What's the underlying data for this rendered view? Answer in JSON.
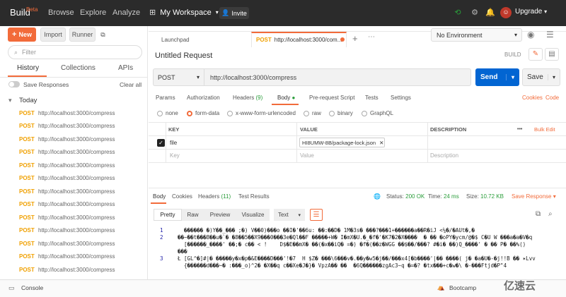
{
  "topbar": {
    "brand": "Build",
    "beta": "Beta",
    "nav": [
      "Browse",
      "Explore",
      "Analyze"
    ],
    "workspace": "My Workspace",
    "invite": "Invite",
    "upgrade": "Upgrade"
  },
  "sidebar": {
    "new_label": "New",
    "import_label": "Import",
    "runner_label": "Runner",
    "filter_placeholder": "Filter",
    "tabs": [
      "History",
      "Collections",
      "APIs"
    ],
    "save_responses": "Save Responses",
    "clear_all": "Clear all",
    "group": "Today",
    "items": [
      {
        "method": "POST",
        "url": "http://localhost:3000/compress"
      },
      {
        "method": "POST",
        "url": "http://localhost:3000/compress"
      },
      {
        "method": "POST",
        "url": "http://localhost:3000/compress"
      },
      {
        "method": "POST",
        "url": "http://localhost:3000/compress"
      },
      {
        "method": "POST",
        "url": "http://localhost:3000/compress"
      },
      {
        "method": "POST",
        "url": "http://localhost:3000/compress"
      },
      {
        "method": "POST",
        "url": "http://localhost:3000/compress"
      },
      {
        "method": "POST",
        "url": "http://localhost:3000/compress"
      },
      {
        "method": "POST",
        "url": "http://localhost:3000/compress"
      },
      {
        "method": "POST",
        "url": "http://localhost:3000/compress"
      },
      {
        "method": "POST",
        "url": "http://localhost:3000/compress"
      },
      {
        "method": "POST",
        "url": "http://localhost:3000/compress"
      },
      {
        "method": "POST",
        "url": "http://localhost:3000/compress"
      }
    ]
  },
  "tabs": {
    "launchpad": "Launchpad",
    "active_method": "POST",
    "active_url": "http://localhost:3000/com..."
  },
  "environment": "No Environment",
  "request": {
    "title": "Untitled Request",
    "build": "BUILD",
    "method": "POST",
    "url": "http://localhost:3000/compress",
    "send": "Send",
    "save": "Save",
    "tabs": {
      "params": "Params",
      "authorization": "Authorization",
      "headers": "Headers",
      "headers_count": "(9)",
      "body": "Body",
      "pre": "Pre-request Script",
      "tests": "Tests",
      "settings": "Settings",
      "cookies": "Cookies",
      "code": "Code"
    },
    "body_types": [
      "none",
      "form-data",
      "x-www-form-urlencoded",
      "raw",
      "binary",
      "GraphQL"
    ],
    "table": {
      "key_header": "KEY",
      "value_header": "VALUE",
      "desc_header": "DESCRIPTION",
      "more": "•••",
      "bulk_edit": "Bulk Edit",
      "row_key": "file",
      "row_value": "HI8UMW-8B/package-lock.json",
      "key_placeholder": "Key",
      "value_placeholder": "Value",
      "desc_placeholder": "Description"
    }
  },
  "response": {
    "tabs": {
      "body": "Body",
      "cookies": "Cookies",
      "headers": "Headers",
      "headers_count": "(11)",
      "tests": "Test Results"
    },
    "status_label": "Status:",
    "status": "200 OK",
    "time_label": "Time:",
    "time": "24 ms",
    "size_label": "Size:",
    "size": "10.72 KB",
    "save_response": "Save Response",
    "views": [
      "Pretty",
      "Raw",
      "Preview",
      "Visualize"
    ],
    "format": "Text",
    "lines": [
      {
        "n": "1",
        "text": "  ������ �)Y��_��� ;�) V��0)���o ��I�'��6u: ��:��D� 1M�3s� ���?���1+������a��R�iJ <¼�/�AUt�,�"
      },
      {
        "n": "2",
        "text": "��~��t���8��u�`� �8��5��X9���0���3e�Ql��F �����+W� I�mX�U.�_�f�'�K7�2�X����  � �� �oPY�ycm/@�$ C�U W ���a�a�V�q"
      },
      {
        "n": "",
        "text": "  [������_����' ��;� c�� < !    D$�E��mX� ��(�x��iQ� =�) �f�(��z�WGG ��$��/���? #�i� ��)Q_����' � �� P� ��%()"
      },
      {
        "n": "",
        "text": "���"
      },
      {
        "n": "3",
        "text": "Ł [GL^�]#|� �����y�x�p�&E����D���'!�7  H $Z� ���\\6���v�.��y�w5�j��/���x4[�b����'|�� ����( j� �a�U�-�j!!B �� ✶Lvv"
      },
      {
        "n": "",
        "text": "  {������d���~� :���_o)^2� �X��q c��Xe�J�}� VpzA�� ��  �6Q������zgAc3~q �=�? �tx���+c�w�\\ �-���Ftjd�P\"4"
      }
    ]
  },
  "statusbar": {
    "console": "Console",
    "bootcamp": "Bootcamp"
  },
  "watermark": "亿速云",
  "colors": {
    "accent": "#f26b3a",
    "send": "#0265d2",
    "post": "#f0a000",
    "status_ok": "#2a9d3a"
  }
}
